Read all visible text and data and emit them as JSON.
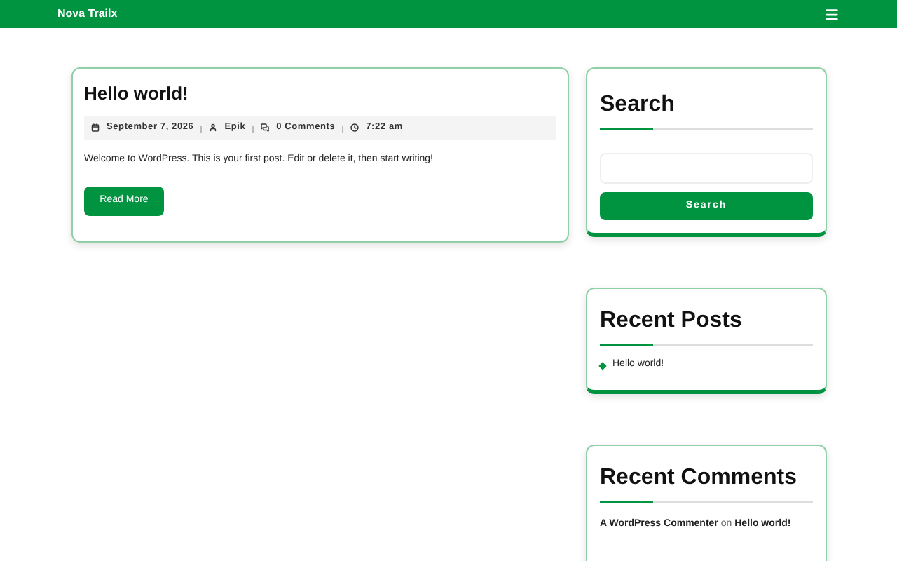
{
  "header": {
    "site_title": "Nova Trailx"
  },
  "post": {
    "title": "Hello world!",
    "meta": [
      {
        "kind": "date",
        "text": "September 7, 2026"
      },
      {
        "kind": "author",
        "text": "Epik"
      },
      {
        "kind": "comments",
        "text": "0 Comments"
      },
      {
        "kind": "time",
        "text": "7:22 am"
      }
    ],
    "excerpt": "Welcome to WordPress. This is your first post. Edit or delete it, then start writing!",
    "button": "Read More"
  },
  "search_widget": {
    "title": "Search",
    "button": "Search"
  },
  "recent_posts": {
    "title": "Recent Posts",
    "items": [
      "Hello world!"
    ]
  },
  "recent_comments": {
    "title": "Recent Comments",
    "items": [
      {
        "author": "A WordPress Commenter",
        "connector": "on",
        "post": "Hello world!"
      }
    ]
  }
}
